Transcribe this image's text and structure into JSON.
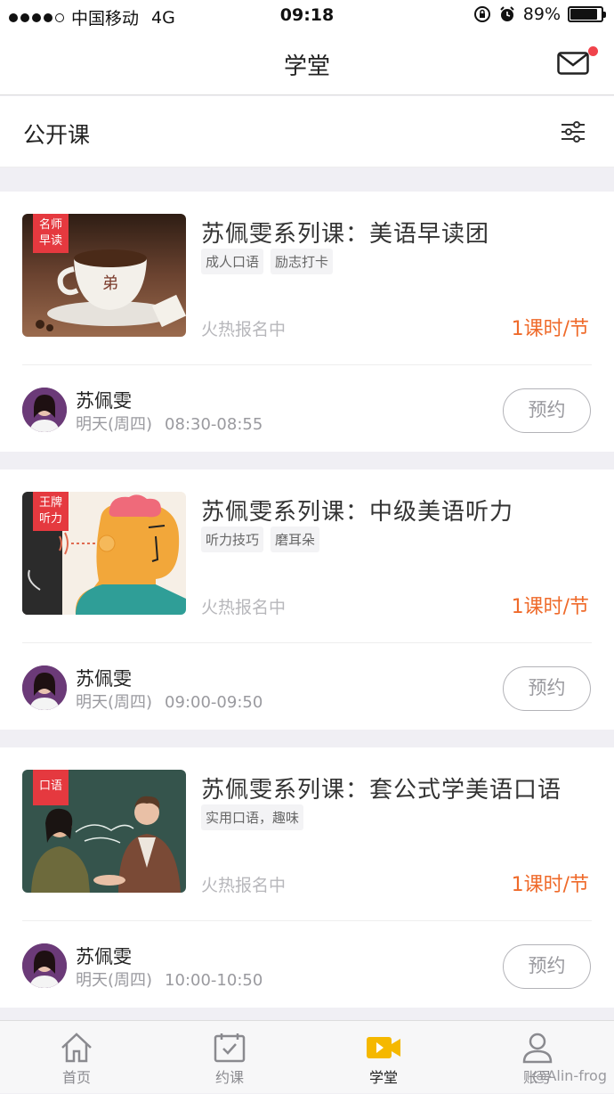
{
  "status_bar": {
    "carrier": "中国移动",
    "network": "4G",
    "time": "09:18",
    "battery": "89%",
    "battery_level": 0.89
  },
  "nav": {
    "title": "学堂"
  },
  "section": {
    "title": "公开课"
  },
  "courses": [
    {
      "badge": [
        "名师",
        "早读"
      ],
      "title": "苏佩雯系列课：美语早读团",
      "tags": [
        "成人口语",
        "励志打卡"
      ],
      "status": "火热报名中",
      "price": "1课时/节",
      "teacher": "苏佩雯",
      "day": "明天(周四)",
      "time_range": "08:30-08:55",
      "button": "预约"
    },
    {
      "badge": [
        "王牌",
        "听力"
      ],
      "title": "苏佩雯系列课：中级美语听力",
      "tags": [
        "听力技巧",
        "磨耳朵"
      ],
      "status": "火热报名中",
      "price": "1课时/节",
      "teacher": "苏佩雯",
      "day": "明天(周四)",
      "time_range": "09:00-09:50",
      "button": "预约"
    },
    {
      "badge": [
        "口语"
      ],
      "title": "苏佩雯系列课：套公式学美语口语",
      "tags": [
        "实用口语，趣味"
      ],
      "status": "火热报名中",
      "price": "1课时/节",
      "teacher": "苏佩雯",
      "day": "明天(周四)",
      "time_range": "10:00-10:50",
      "button": "预约"
    }
  ],
  "tabs": [
    {
      "label": "首页",
      "icon": "home-icon"
    },
    {
      "label": "约课",
      "icon": "calendar-check-icon"
    },
    {
      "label": "学堂",
      "icon": "video-icon",
      "active": true
    },
    {
      "label": "账号",
      "icon": "user-icon"
    }
  ],
  "watermark": "@Alin-frog",
  "colors": {
    "accent": "#f5b800",
    "price": "#ef6a2a",
    "badge": "#e5393f",
    "notify": "#f0434b"
  }
}
